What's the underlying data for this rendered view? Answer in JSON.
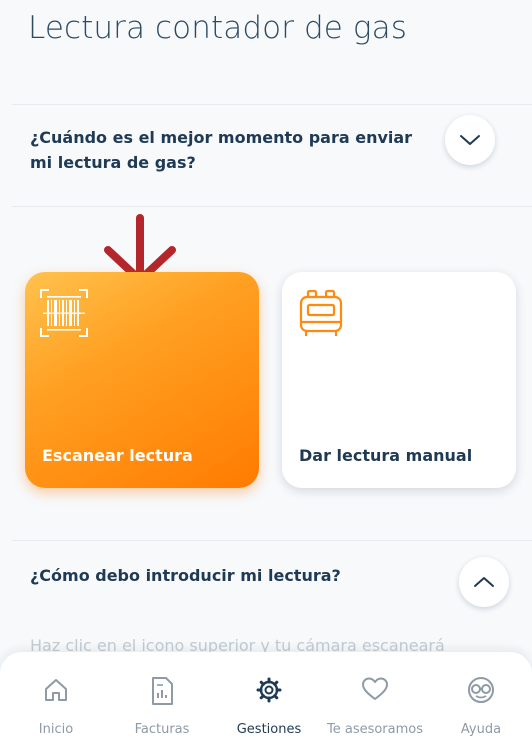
{
  "page": {
    "title": "Lectura contador de gas"
  },
  "faq": [
    {
      "question_line1": "¿Cuándo es el mejor momento para enviar",
      "question_line2": "mi lectura de gas?",
      "toggle_icon": "chevron-down-icon"
    },
    {
      "question_line1": "¿Cómo debo introducir mi lectura?",
      "toggle_icon": "chevron-up-icon"
    }
  ],
  "options": {
    "scan": {
      "label": "Escanear lectura",
      "icon": "barcode-scan-icon"
    },
    "manual": {
      "label": "Dar lectura manual",
      "icon": "gas-meter-icon"
    }
  },
  "faq_answer_partial": "Haz clic en el icono superior y tu cámara escaneará",
  "bottom_nav": [
    {
      "label": "Inicio",
      "icon": "home-icon",
      "active": false
    },
    {
      "label": "Facturas",
      "icon": "invoice-icon",
      "active": false
    },
    {
      "label": "Gestiones",
      "icon": "settings-gear-icon",
      "active": true
    },
    {
      "label": "Te asesoramos",
      "icon": "heart-icon",
      "active": false
    },
    {
      "label": "Ayuda",
      "icon": "help-icon",
      "active": false
    }
  ],
  "colors": {
    "primary_text": "#1f3a54",
    "title_text": "#2d4a63",
    "accent_orange": "#ff8a0d",
    "arrow_red": "#b3262b",
    "nav_inactive": "#8e9aa6"
  }
}
